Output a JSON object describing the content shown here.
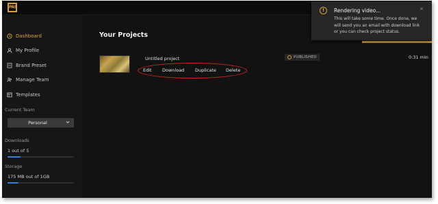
{
  "app": {
    "logo_text": "PAS"
  },
  "sidebar": {
    "items": [
      {
        "label": "Dashboard",
        "icon": "clock-icon"
      },
      {
        "label": "My Profile",
        "icon": "user-icon"
      },
      {
        "label": "Brand Preset",
        "icon": "document-icon"
      },
      {
        "label": "Manage Team",
        "icon": "team-icon"
      },
      {
        "label": "Templates",
        "icon": "grid-icon"
      }
    ],
    "current_team_label": "Current Team",
    "team_value": "Personal",
    "downloads_label": "Downloads",
    "downloads_value": "1 out of 5",
    "downloads_progress": 0.2,
    "storage_label": "Storage",
    "storage_value": "175 MB out of 1GB",
    "storage_progress": 0.17
  },
  "main": {
    "title": "Your Projects",
    "project": {
      "name": "Untitled project",
      "actions": [
        "Edit",
        "Download",
        "Duplicate",
        "Delete"
      ],
      "status": "PUBLISHED",
      "duration": "0:31 min"
    }
  },
  "toast": {
    "title": "Rendering video...",
    "message": "This will take some time. Once done, we will send you an email with download link or you can check project status.",
    "close": "×"
  },
  "colors": {
    "accent": "#d4a13c",
    "progress": "#2f7fd6",
    "highlight": "#dd2222"
  }
}
